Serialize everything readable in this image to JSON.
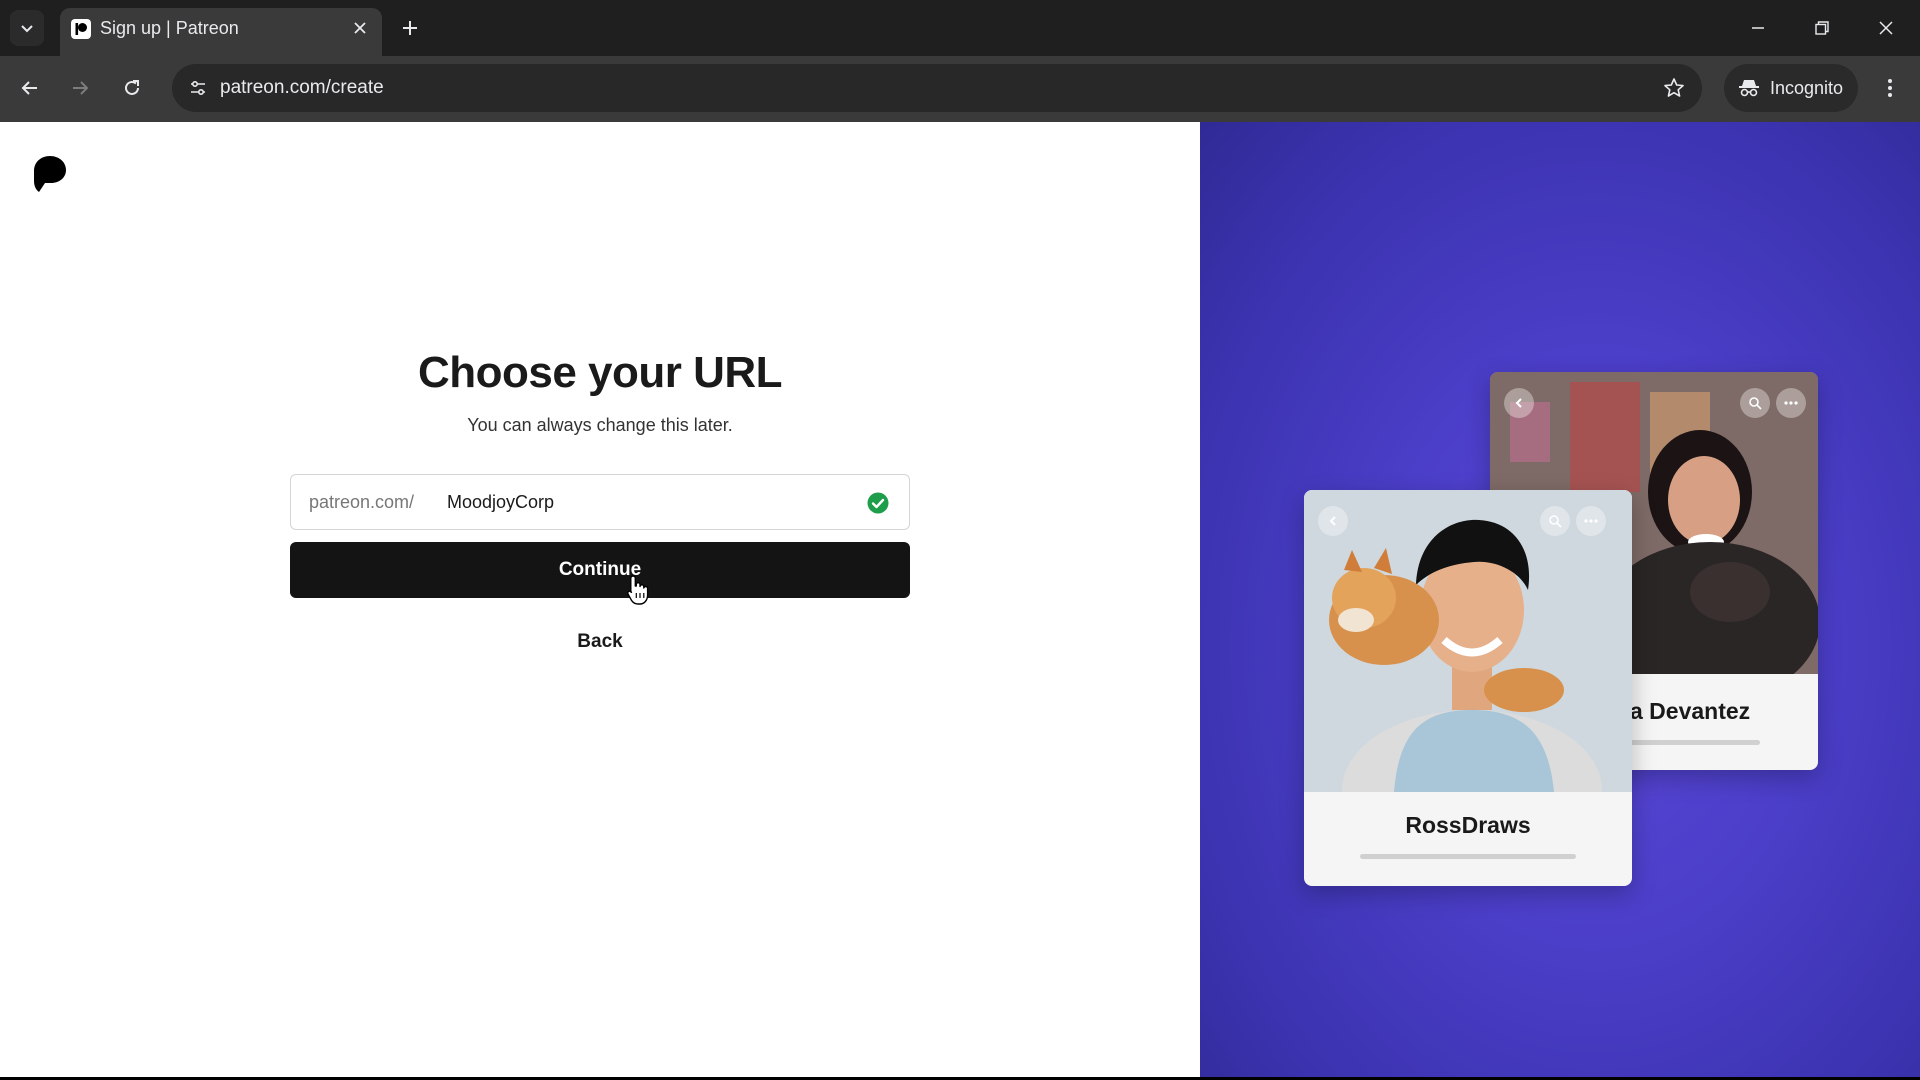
{
  "browser": {
    "tab_title": "Sign up | Patreon",
    "url": "patreon.com/create",
    "incognito_label": "Incognito",
    "icons": {
      "tab_list": "chevron-down-icon",
      "tab_favicon": "patreon-icon",
      "tab_close": "close-icon",
      "new_tab": "plus-icon",
      "minimize": "minimize-icon",
      "restore": "restore-icon",
      "close_window": "close-icon",
      "back": "arrow-left-icon",
      "forward": "arrow-right-icon",
      "reload": "reload-icon",
      "site_info": "tune-icon",
      "bookmark": "star-icon",
      "incognito": "incognito-icon",
      "menu": "kebab-menu-icon"
    }
  },
  "page": {
    "heading": "Choose your URL",
    "subheading": "You can always change this later.",
    "url_prefix": "patreon.com/",
    "url_value": "MoodjoyCorp",
    "continue_label": "Continue",
    "back_label": "Back",
    "valid_color": "#1e9e4a"
  },
  "promo": {
    "card_front_name": "RossDraws",
    "card_back_name": "a Devantez"
  },
  "colors": {
    "accent_panel": "#4b3ec8",
    "button": "#141414"
  }
}
